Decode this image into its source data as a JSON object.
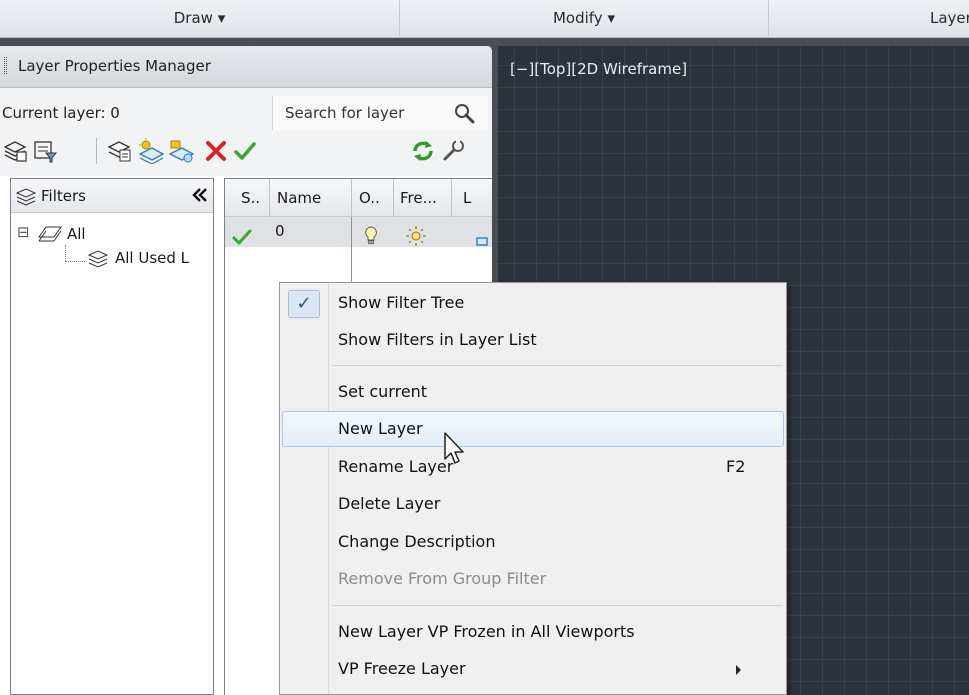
{
  "ribbon": {
    "panels": [
      {
        "label": "Draw"
      },
      {
        "label": "Modify"
      },
      {
        "label": "Layer"
      }
    ],
    "dropdown_glyph": "▾"
  },
  "palette": {
    "title": "Layer Properties Manager",
    "current_layer": "Current layer: 0",
    "search_placeholder": "Search for layer",
    "toolbar_icons": [
      "new-property-filter-icon",
      "new-group-filter-icon",
      "layer-states-manager-icon",
      "new-layer-icon",
      "new-layer-vp-frozen-icon",
      "delete-layer-icon",
      "set-current-icon",
      "refresh-icon",
      "settings-icon"
    ]
  },
  "filters": {
    "header": "Filters",
    "collapse_glyph": "«",
    "tree": [
      {
        "label": "All",
        "expander": "⊟"
      },
      {
        "label": "All Used L"
      }
    ]
  },
  "layer_list": {
    "columns": [
      "S..",
      "Name",
      "O..",
      "Fre...",
      "L"
    ],
    "rows": [
      {
        "status": "current",
        "name": "0",
        "on": true,
        "frozen": false
      }
    ]
  },
  "viewport": {
    "label": "[−][Top][2D Wireframe]"
  },
  "context_menu": {
    "items": [
      {
        "label": "Show Filter Tree",
        "checked": true
      },
      {
        "label": "Show Filters in Layer List"
      },
      {
        "label": "Set current"
      },
      {
        "label": "New Layer",
        "hover": true
      },
      {
        "label": "Rename Layer",
        "shortcut": "F2"
      },
      {
        "label": "Delete Layer"
      },
      {
        "label": "Change Description"
      },
      {
        "label": "Remove From Group Filter",
        "disabled": true
      },
      {
        "label": "New Layer VP Frozen in All Viewports"
      },
      {
        "label": "VP Freeze Layer",
        "submenu": true
      }
    ],
    "check_glyph": "✓"
  },
  "colors": {
    "viewport_bg": "#2b323c",
    "hover_border": "#a6c8ec",
    "check_blue": "#1e4f9a",
    "accept_green": "#3aa836",
    "delete_red": "#d32424"
  }
}
